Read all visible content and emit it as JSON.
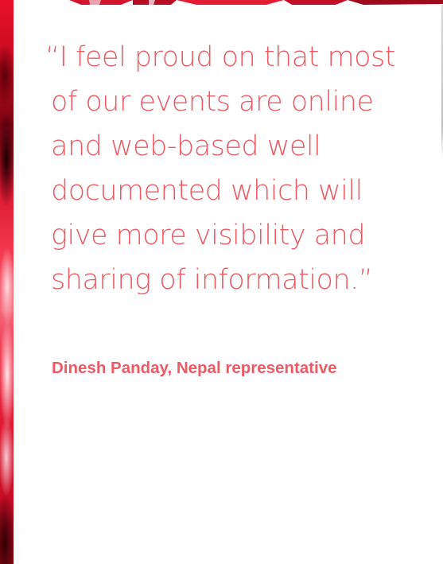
{
  "quote": {
    "lines": [
      "“I feel proud on that most",
      "of our events are online",
      "and web-based well",
      "documented which will",
      "give more visibility and",
      "sharing of information.”"
    ]
  },
  "attribution": "Dinesh Panday, Nepal representative",
  "colors": {
    "accent": "#ee5a63",
    "backdrop_red": "#e01a33",
    "background": "#ffffff"
  }
}
